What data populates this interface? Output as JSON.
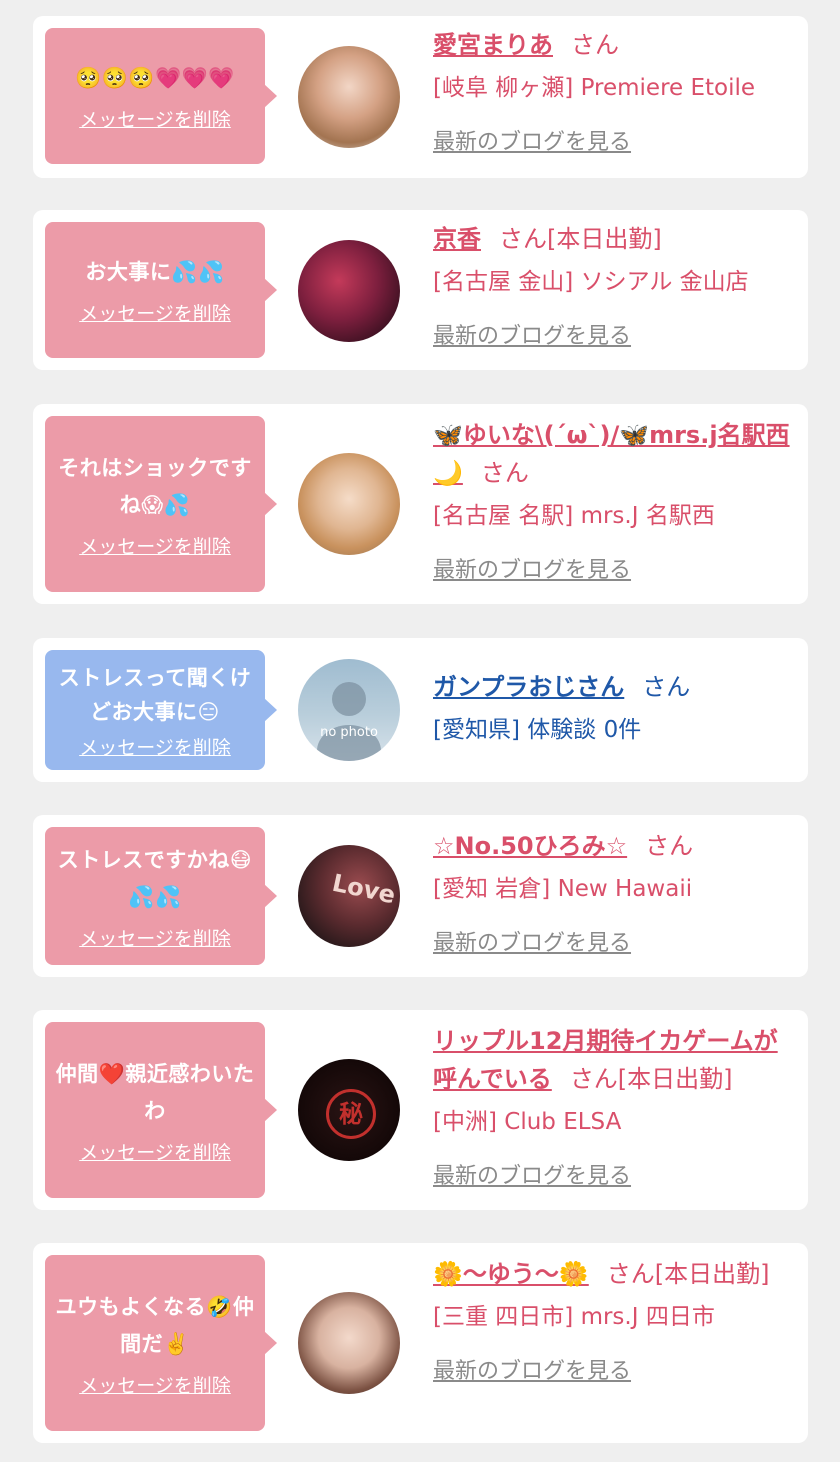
{
  "delete_label": "メッセージを削除",
  "blog_label": "最新のブログを見る",
  "items": [
    {
      "message": "🥺🥺🥺💗💗💗",
      "name": "愛宮まりあ",
      "suffix": "さん",
      "shop": "[岐阜 柳ヶ瀬] Premiere Etoile"
    },
    {
      "message": "お大事に💦💦",
      "name": "京香",
      "suffix": "さん[本日出勤]",
      "shop": "[名古屋 金山] ソシアル 金山店"
    },
    {
      "message": "それはショックですね😱💦",
      "name": "🦋ゆいな\\(´ω`)/🦋mrs.j名駅西🌙",
      "suffix": "さん",
      "shop": "[名古屋 名駅] mrs.J 名駅西"
    },
    {
      "message": "ストレスって聞くけどお大事に😑",
      "name": "ガンプラおじさん",
      "suffix": "さん",
      "shop": "[愛知県] 体験談 0件",
      "avatar_text": "no photo"
    },
    {
      "message": "ストレスですかね😷💦💦",
      "name": "☆No.50ひろみ☆",
      "suffix": "さん",
      "shop": "[愛知 岩倉] New Hawaii",
      "avatar_text": "Love"
    },
    {
      "message": "仲間❤️親近感わいたわ",
      "name": "リップル12月期待イカゲームが呼んでいる",
      "suffix": "さん[本日出勤]",
      "shop": "[中洲] Club ELSA",
      "avatar_text": "秘"
    },
    {
      "message": "ユウもよくなる🤣仲間だ✌️",
      "name": "🌼〜ゆう〜🌼",
      "suffix": "さん[本日出勤]",
      "shop": "[三重 四日市] mrs.J 四日市"
    }
  ],
  "colors": {
    "background": "#efefef",
    "card": "#ffffff",
    "bubble_pink": "#ec9ba8",
    "bubble_blue": "#98b8ee",
    "name_pink": "#d94f6a",
    "name_blue": "#1f58a8",
    "blog_gray": "#8a8a8a"
  }
}
